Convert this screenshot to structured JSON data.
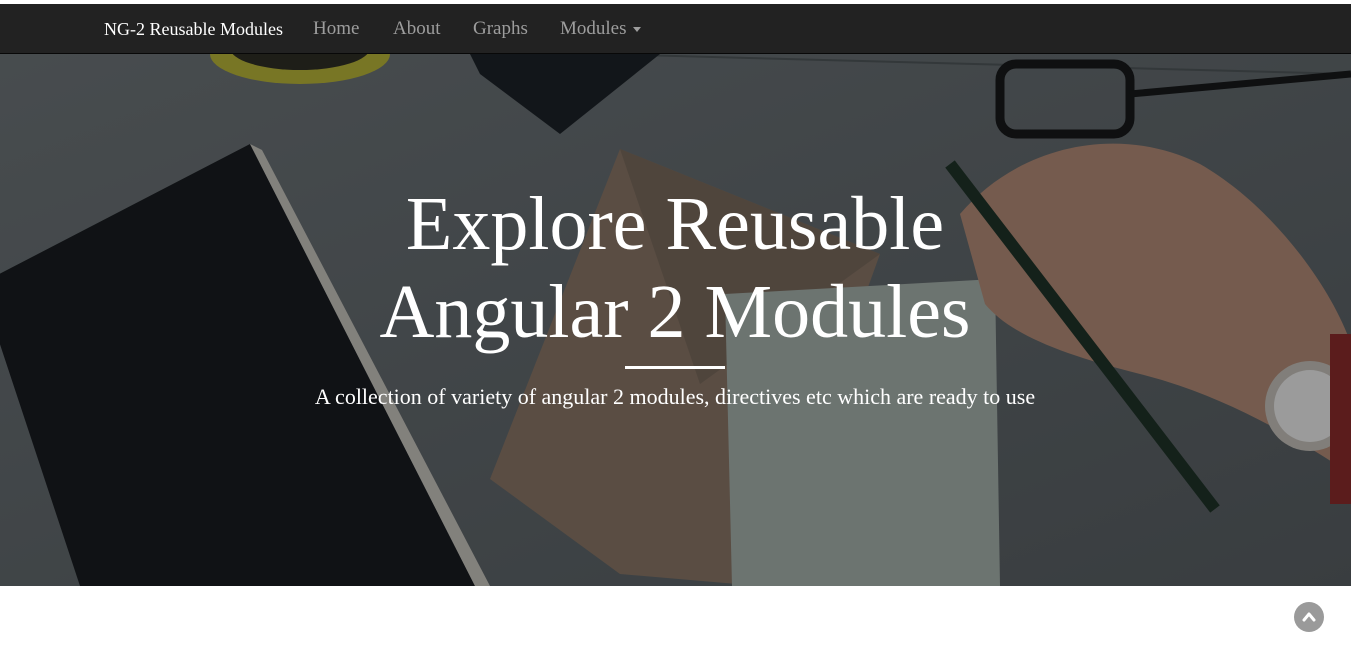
{
  "navbar": {
    "brand": "NG-2 Reusable Modules",
    "items": [
      {
        "label": "Home"
      },
      {
        "label": "About"
      },
      {
        "label": "Graphs"
      },
      {
        "label": "Modules"
      }
    ]
  },
  "hero": {
    "title_line1": "Explore Reusable",
    "title_line2": "Angular 2 Modules",
    "subtitle": "A collection of variety of angular 2 modules, directives etc which are ready to use"
  },
  "icons": {
    "modules_dropdown": "caret-down-icon",
    "scroll_top": "chevron-up-icon"
  },
  "colors": {
    "navbar_bg": "#222222",
    "nav_link": "#9d9d9d",
    "brand": "#ffffff",
    "scroll_button": "#9a9a9a"
  }
}
